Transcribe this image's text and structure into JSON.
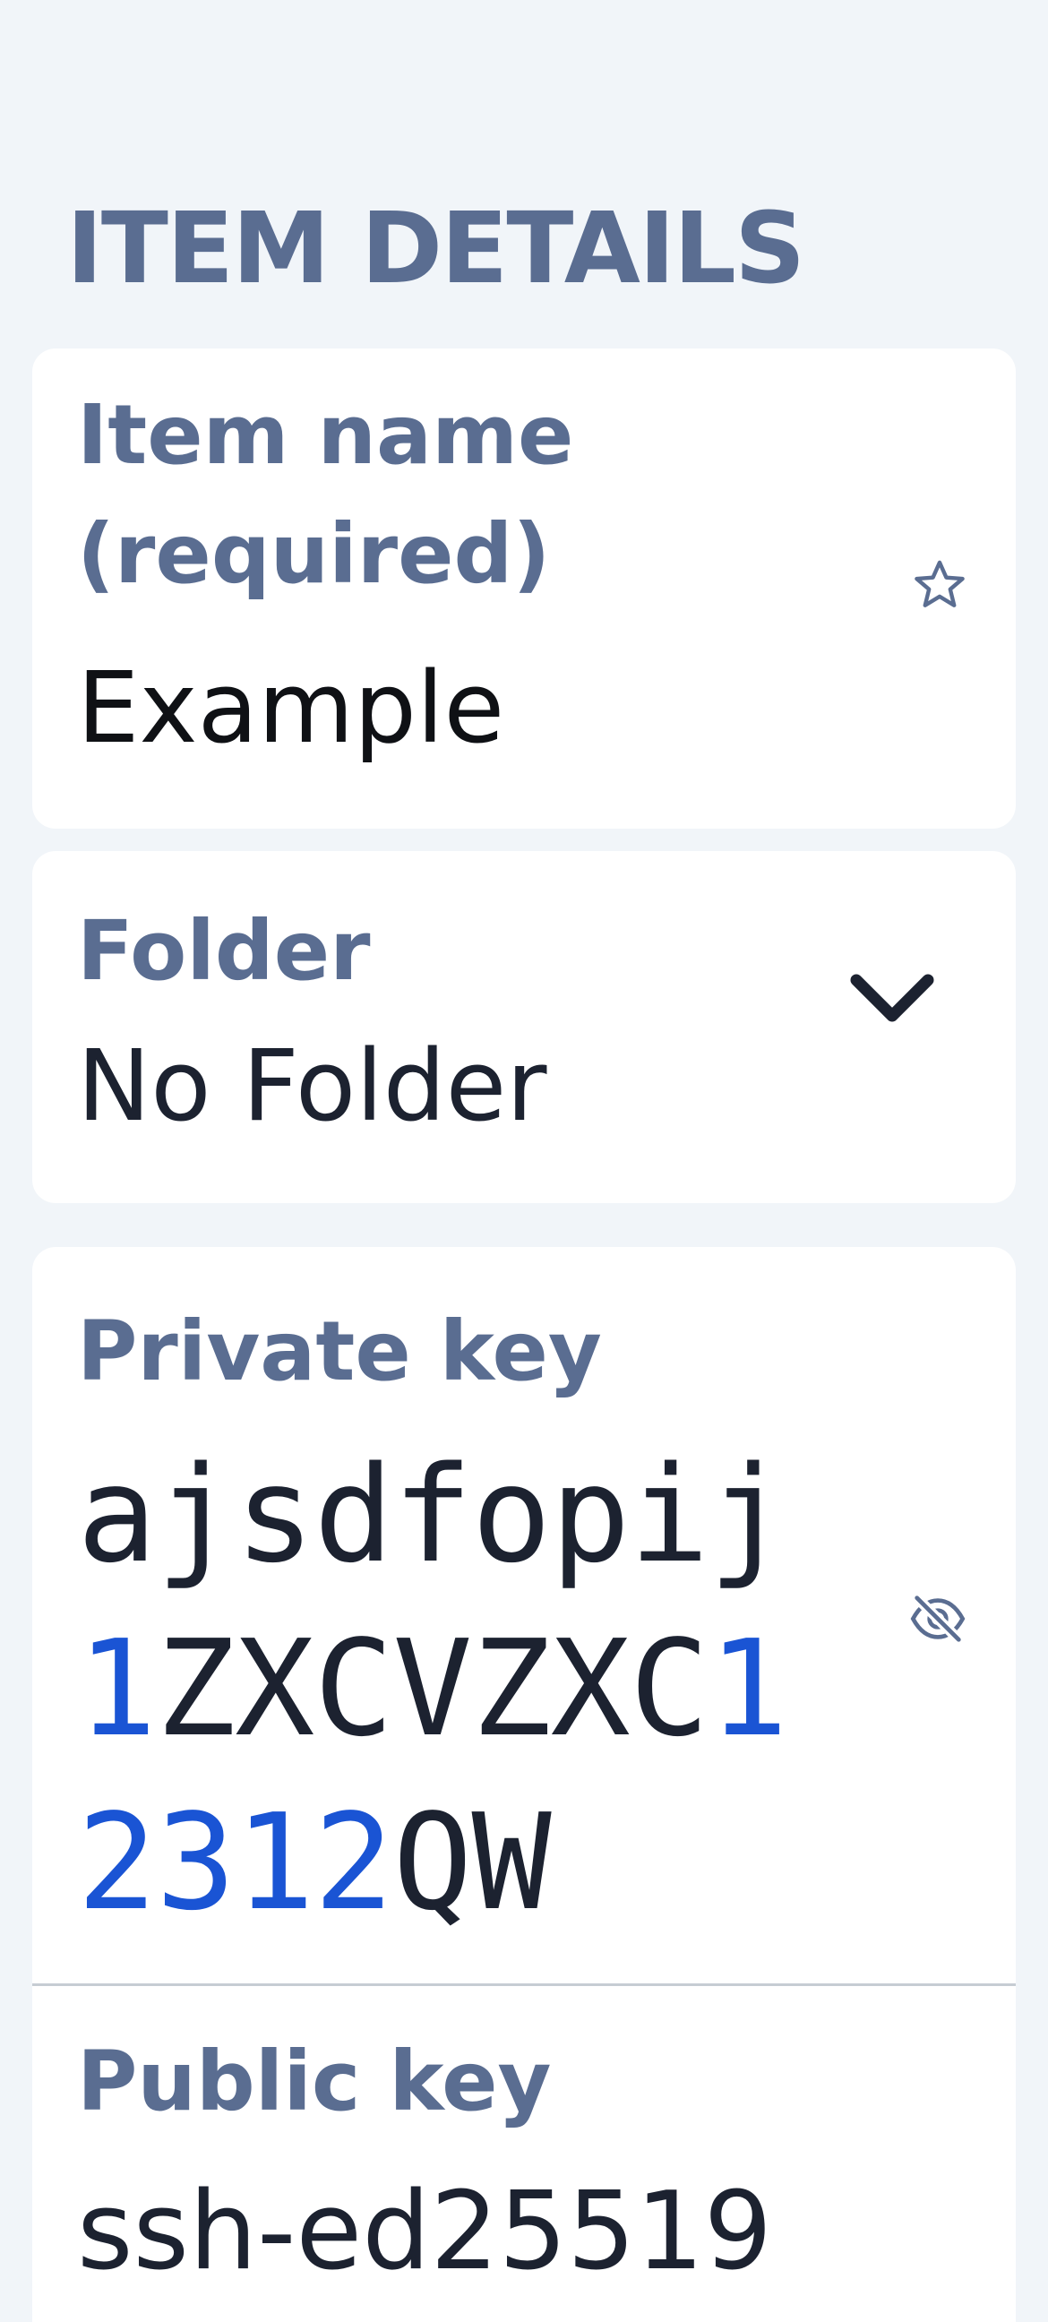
{
  "section": {
    "title": "ITEM DETAILS"
  },
  "item_name": {
    "label": "Item name (required)",
    "value": "Example",
    "favorite_icon": "star-icon"
  },
  "folder": {
    "label": "Folder",
    "value": "No Folder",
    "dropdown_icon": "chevron-down-icon"
  },
  "private_key": {
    "label": "Private key",
    "lines": [
      [
        {
          "text": "ajsdfopij",
          "kind": "text"
        }
      ],
      [
        {
          "text": "1",
          "kind": "num"
        },
        {
          "text": "ZXCVZXC",
          "kind": "text"
        },
        {
          "text": "1",
          "kind": "num"
        }
      ],
      [
        {
          "text": "2312",
          "kind": "num"
        },
        {
          "text": "QW",
          "kind": "text"
        }
      ]
    ],
    "visibility_icon": "eye-off-icon"
  },
  "public_key": {
    "label": "Public key",
    "value": "ssh-ed25519"
  },
  "colors": {
    "label": "#5a6d91",
    "digit": "#1a54d4",
    "background": "#f1f5f9",
    "card": "#ffffff"
  }
}
